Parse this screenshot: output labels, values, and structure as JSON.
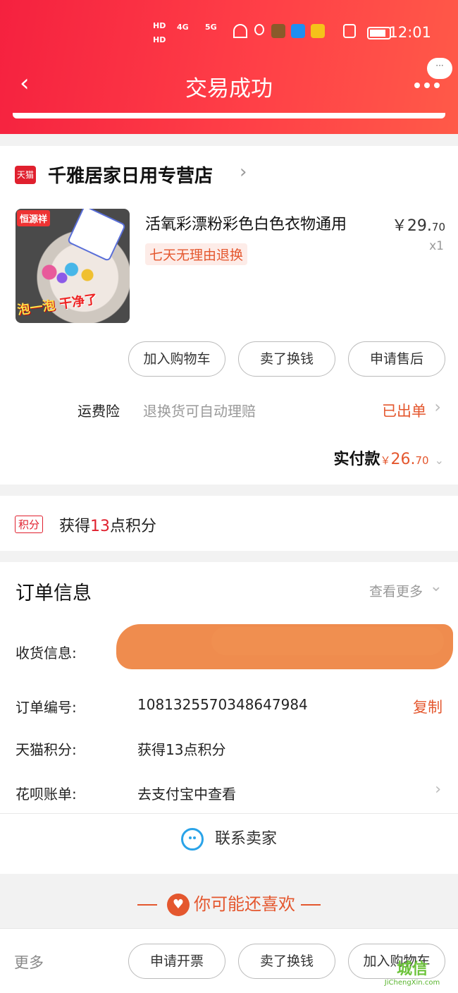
{
  "status_bar": {
    "time": "12:01",
    "hd1": "HD",
    "hd2": "HD",
    "signal1": "4G",
    "signal2": "5G"
  },
  "header": {
    "title": "交易成功",
    "bubble": "···"
  },
  "store": {
    "badge": "天猫",
    "name": "千雅居家日用专营店",
    "product": {
      "title": "活氧彩漂粉彩色白色衣物通用",
      "price_main": "￥29.",
      "price_cents": "70",
      "qty": "x1",
      "tag": "七天无理由退换",
      "thumb_brand": "恒源祥",
      "thumb_caption_a": "泡一泡",
      "thumb_caption_b": "干净了"
    },
    "actions": [
      "加入购物车",
      "卖了换钱",
      "申请售后"
    ],
    "insurance": {
      "label": "运费险",
      "desc": "退换货可自动理赔",
      "status": "已出单"
    },
    "paid": {
      "label": "实付款",
      "currency": "￥",
      "amount_main": "26.",
      "amount_cents": "70"
    }
  },
  "points": {
    "badge": "积分",
    "prefix": "获得",
    "count": "13",
    "suffix": "点积分"
  },
  "order": {
    "title": "订单信息",
    "more": "查看更多",
    "rows": [
      {
        "label": "收货信息:",
        "value": ""
      },
      {
        "label": "订单编号:",
        "value": "1081325570348647984"
      },
      {
        "label": "天猫积分:",
        "value": "获得13点积分"
      },
      {
        "label": "花呗账单:",
        "value": "去支付宝中查看"
      }
    ],
    "copy": "复制",
    "contact": "联系卖家"
  },
  "recommend": {
    "title": "你可能还喜欢"
  },
  "bottom_bar": {
    "more": "更多",
    "buttons": [
      "申请开票",
      "卖了换钱",
      "加入购物车"
    ]
  },
  "watermark": {
    "logo": "城信",
    "site": "JiChengXin.com"
  },
  "colors": {
    "header_red": "#f5213f",
    "accent_orange": "#e4572e",
    "tmall_red": "#e0202e",
    "contact_blue": "#2aa3e8"
  }
}
